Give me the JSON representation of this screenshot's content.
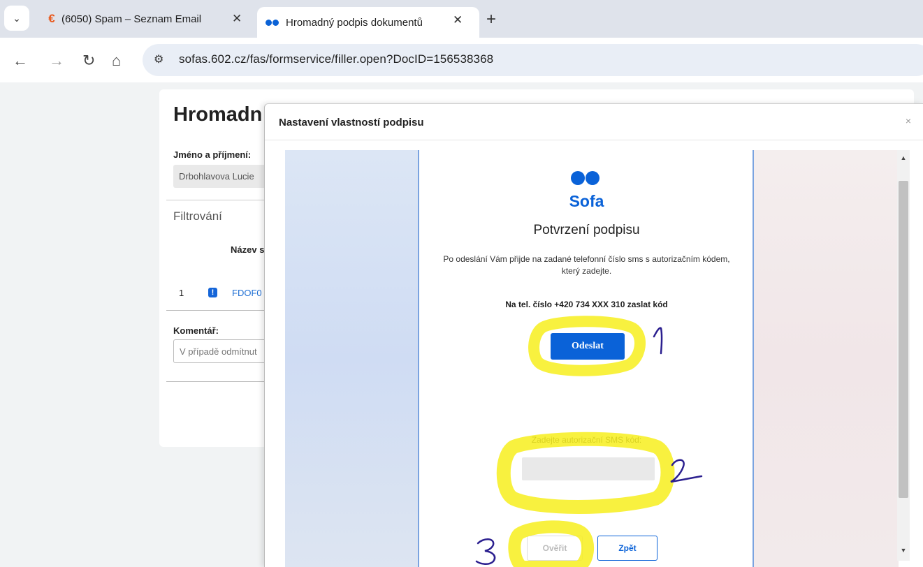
{
  "browser": {
    "tabs": [
      {
        "title": "(6050) Spam – Seznam Email",
        "favicon": "euro-icon"
      },
      {
        "title": "Hromadný podpis dokumentů",
        "favicon": "sofa-dots-icon",
        "active": true
      }
    ],
    "url": "sofas.602.cz/fas/formservice/filler.open?DocID=156538368"
  },
  "background_page": {
    "title": "Hromadn",
    "name_label": "Jméno a příjmení:",
    "name_value": "Drbohlavova Lucie",
    "filter_label": "Filtrování",
    "column_header": "Název s",
    "row_number": "1",
    "row_link": "FDOF0",
    "comment_label": "Komentář:",
    "comment_placeholder": "V případě odmítnut"
  },
  "modal": {
    "title": "Nastavení vlastností podpisu",
    "close_label": "×",
    "logo_text": "Sofa",
    "heading": "Potvrzení podpisu",
    "description": "Po odeslání Vám přijde na zadané telefonní číslo sms s autorizačním kódem, který zadejte.",
    "phone_text": "Na tel. číslo +420 734 XXX 310 zaslat kód",
    "send_button": "Odeslat",
    "sms_label": "Zadejte autorizační SMS kód:",
    "sms_value": "",
    "verify_button": "Ověřit",
    "back_button": "Zpět"
  },
  "annotations": {
    "highlight_color": "#f7ee1d",
    "ink_color": "#2b1f8f"
  }
}
